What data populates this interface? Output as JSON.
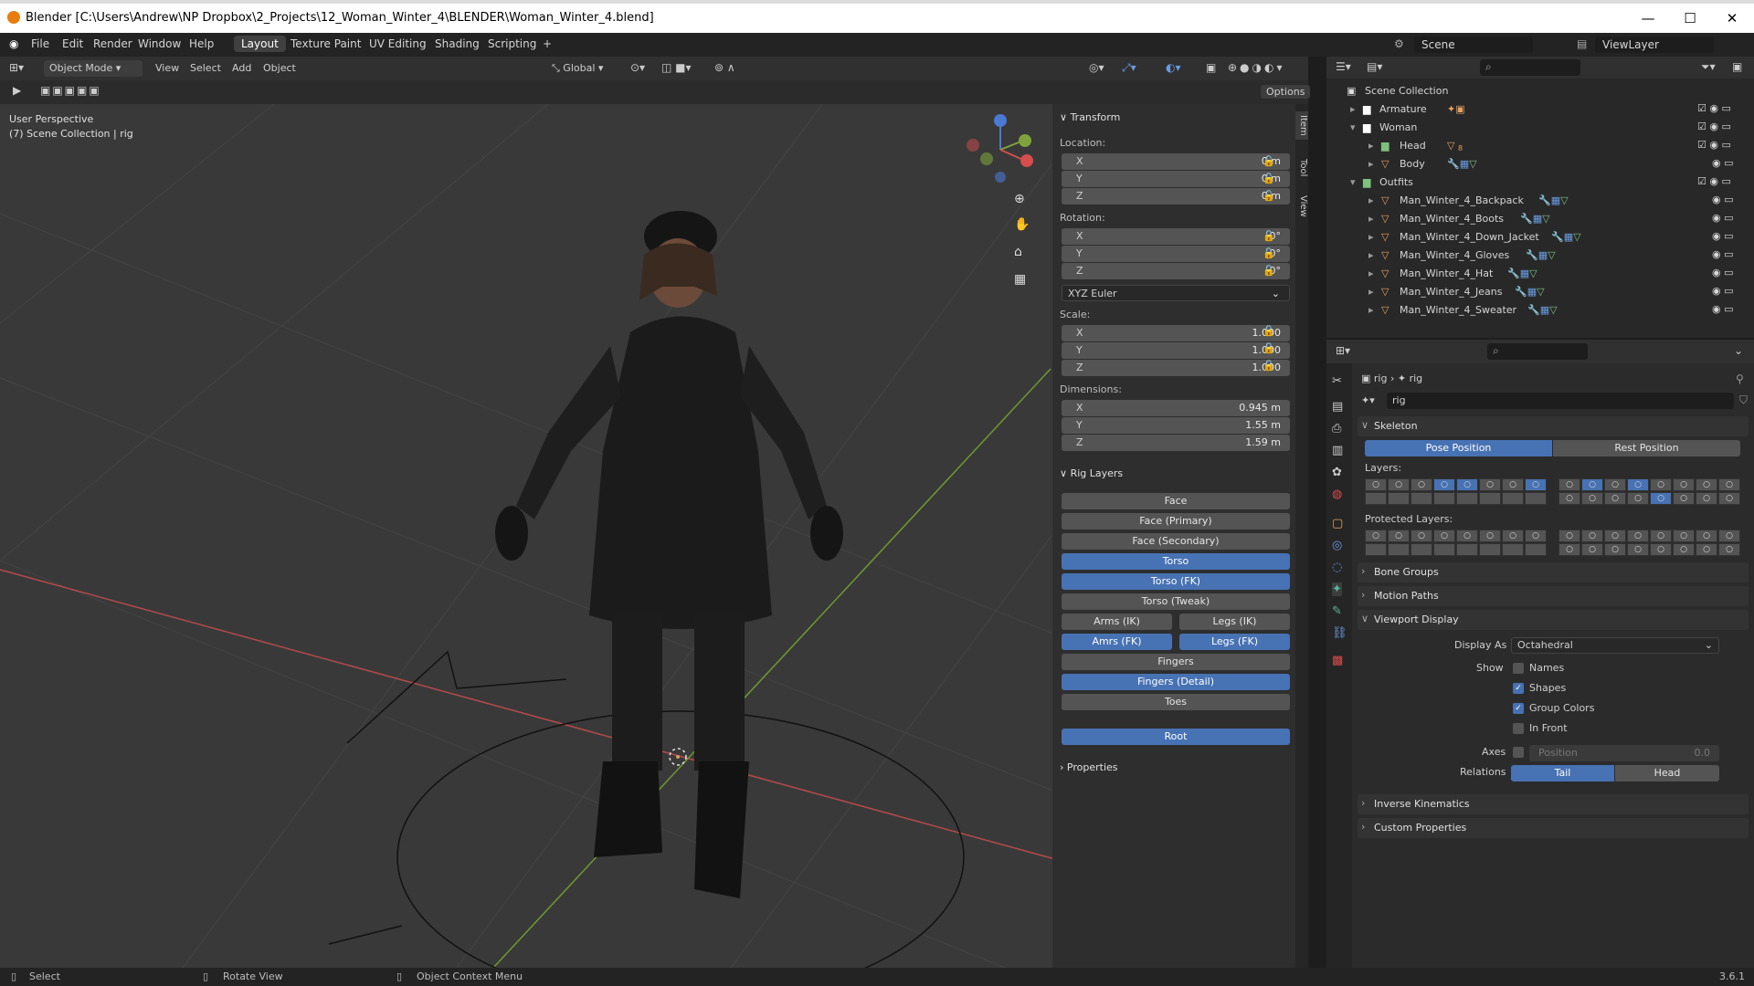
{
  "window": {
    "title": "Blender [C:\\Users\\Andrew\\NP Dropbox\\2_Projects\\12_Woman_Winter_4\\BLENDER\\Woman_Winter_4.blend]",
    "minimize": "—",
    "maximize": "☐",
    "close": "✕"
  },
  "menu": {
    "items": [
      "File",
      "Edit",
      "Render",
      "Window",
      "Help"
    ],
    "tabs": [
      "Layout",
      "Texture Paint",
      "UV Editing",
      "Shading",
      "Scripting"
    ],
    "add_tab": "+",
    "scene": "Scene",
    "view_layer": "ViewLayer"
  },
  "viewport_header": {
    "mode": "Object Mode",
    "menus": [
      "View",
      "Select",
      "Add",
      "Object"
    ],
    "orientation": "Global",
    "options": "Options"
  },
  "viewport": {
    "perspective": "User Perspective",
    "collection": "(7) Scene Collection | rig"
  },
  "npanel": {
    "transform": "Transform",
    "location_label": "Location:",
    "location": [
      {
        "axis": "X",
        "value": "0 m"
      },
      {
        "axis": "Y",
        "value": "0 m"
      },
      {
        "axis": "Z",
        "value": "0 m"
      }
    ],
    "rotation_label": "Rotation:",
    "rotation": [
      {
        "axis": "X",
        "value": "0°"
      },
      {
        "axis": "Y",
        "value": "0°"
      },
      {
        "axis": "Z",
        "value": "0°"
      }
    ],
    "rotation_mode": "XYZ Euler",
    "scale_label": "Scale:",
    "scale": [
      {
        "axis": "X",
        "value": "1.000"
      },
      {
        "axis": "Y",
        "value": "1.000"
      },
      {
        "axis": "Z",
        "value": "1.000"
      }
    ],
    "dimensions_label": "Dimensions:",
    "dimensions": [
      {
        "axis": "X",
        "value": "0.945 m"
      },
      {
        "axis": "Y",
        "value": "1.55 m"
      },
      {
        "axis": "Z",
        "value": "1.59 m"
      }
    ],
    "rig_layers": "Rig Layers",
    "face": "Face",
    "face_primary": "Face (Primary)",
    "face_secondary": "Face (Secondary)",
    "torso": "Torso",
    "torso_fk": "Torso (FK)",
    "torso_tweak": "Torso (Tweak)",
    "arms_ik": "Arms (IK)",
    "legs_ik": "Legs (IK)",
    "arms_fk": "Amrs (FK)",
    "legs_fk": "Legs (FK)",
    "fingers": "Fingers",
    "fingers_detail": "Fingers (Detail)",
    "toes": "Toes",
    "root": "Root",
    "properties": "Properties",
    "tabs": [
      "Item",
      "Tool",
      "View"
    ]
  },
  "outliner": {
    "root": "Scene Collection",
    "rows": [
      {
        "name": "Armature",
        "level": 1
      },
      {
        "name": "Woman",
        "level": 1
      },
      {
        "name": "Head",
        "level": 2
      },
      {
        "name": "Body",
        "level": 2
      },
      {
        "name": "Outfits",
        "level": 1
      },
      {
        "name": "Man_Winter_4_Backpack",
        "level": 2
      },
      {
        "name": "Man_Winter_4_Boots",
        "level": 2
      },
      {
        "name": "Man_Winter_4_Down_Jacket",
        "level": 2
      },
      {
        "name": "Man_Winter_4_Gloves",
        "level": 2
      },
      {
        "name": "Man_Winter_4_Hat",
        "level": 2
      },
      {
        "name": "Man_Winter_4_Jeans",
        "level": 2
      },
      {
        "name": "Man_Winter_4_Sweater",
        "level": 2
      }
    ],
    "head_modifier_count": "8"
  },
  "properties": {
    "breadcrumb_1": "rig",
    "breadcrumb_2": "rig",
    "data_name": "rig",
    "skeleton": "Skeleton",
    "pose_position": "Pose Position",
    "rest_position": "Rest Position",
    "layers": "Layers:",
    "protected_layers": "Protected Layers:",
    "bone_groups": "Bone Groups",
    "motion_paths": "Motion Paths",
    "viewport_display": "Viewport Display",
    "display_as_label": "Display As",
    "display_as": "Octahedral",
    "show_label": "Show",
    "names": "Names",
    "shapes": "Shapes",
    "group_colors": "Group Colors",
    "in_front": "In Front",
    "axes_label": "Axes",
    "axes_position": "Position",
    "axes_value": "0.0",
    "relations_label": "Relations",
    "tail": "Tail",
    "head": "Head",
    "inverse_kinematics": "Inverse Kinematics",
    "custom_properties": "Custom Properties"
  },
  "status": {
    "select": "Select",
    "rotate": "Rotate View",
    "context": "Object Context Menu",
    "version": "3.6.1"
  }
}
